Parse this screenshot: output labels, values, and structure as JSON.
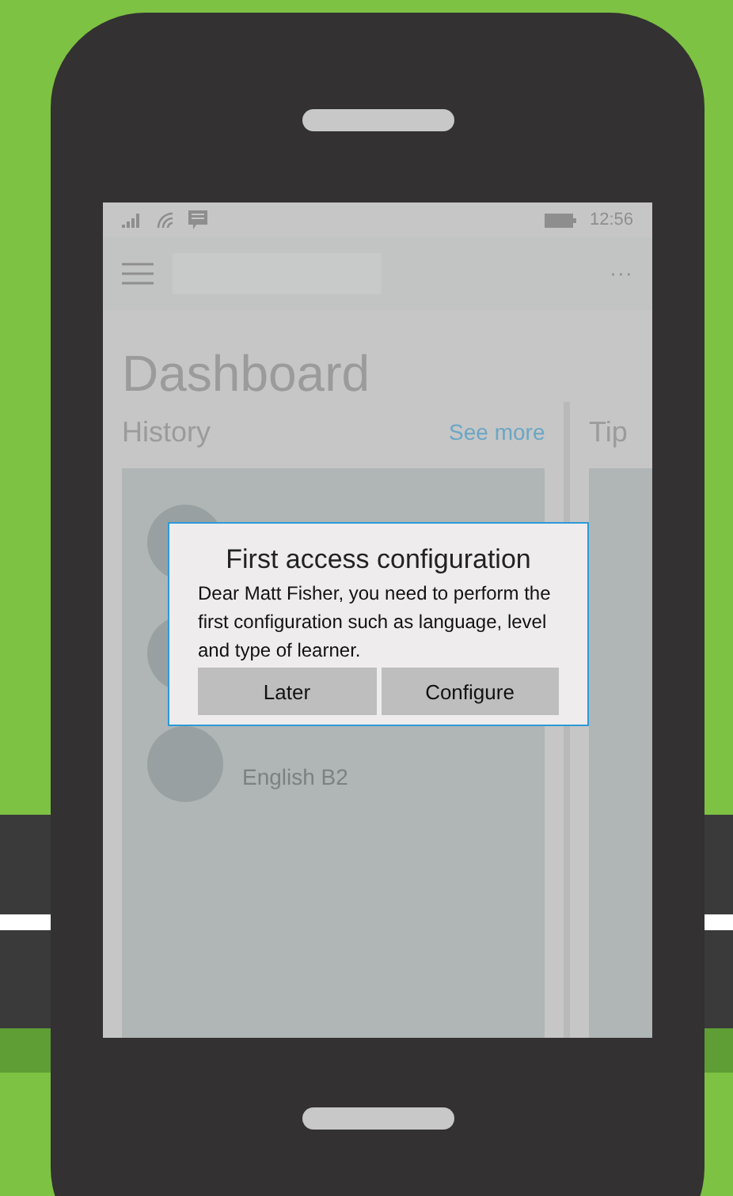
{
  "status_bar": {
    "time": "12:56"
  },
  "app_bar": {
    "more": "···"
  },
  "page": {
    "title": "Dashboard"
  },
  "history": {
    "heading": "History",
    "link": "See more",
    "items": [
      {
        "kind": "covered"
      },
      {
        "kind": "covered"
      },
      {
        "kind": "entry",
        "subtitle": "English B2"
      }
    ]
  },
  "tips": {
    "heading": "Tip"
  },
  "dialog": {
    "title": "First access configuration",
    "message": "Dear Matt Fisher, you need to perform the first configuration such as language, level and type of learner.",
    "buttons": [
      "Later",
      "Configure"
    ]
  }
}
